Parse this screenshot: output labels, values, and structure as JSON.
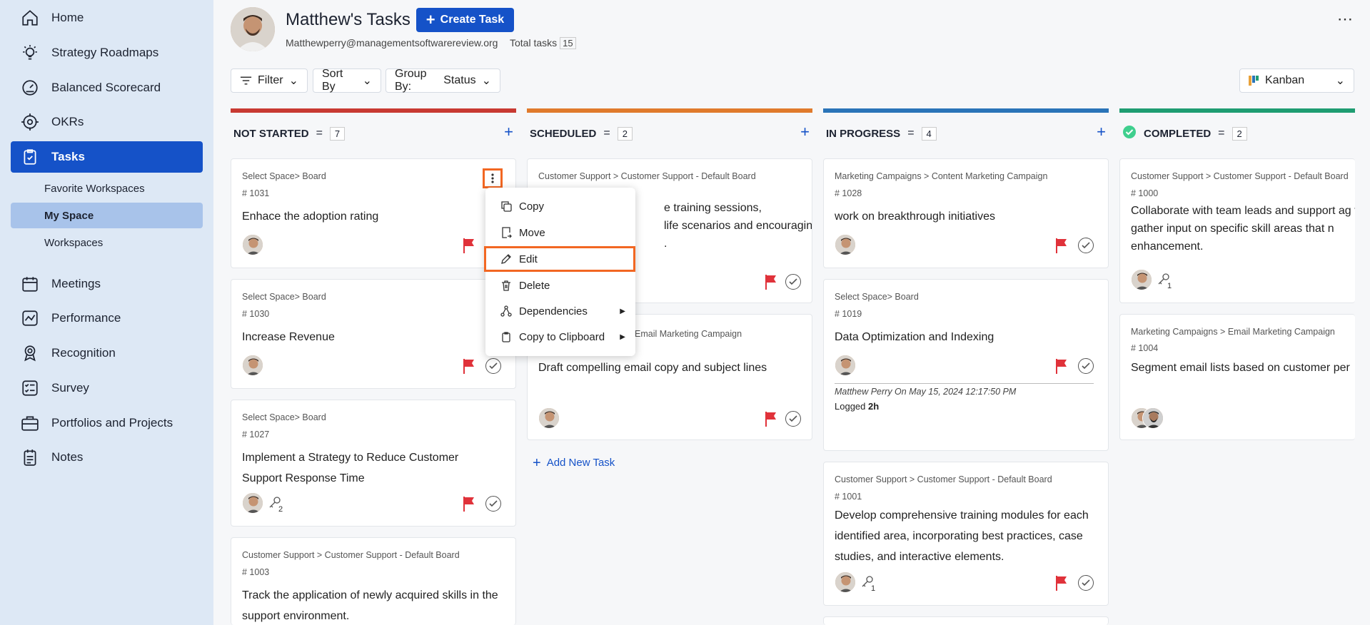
{
  "sidebar": {
    "items": [
      {
        "label": "Home",
        "icon": "home-icon"
      },
      {
        "label": "Strategy Roadmaps",
        "icon": "lightbulb-icon"
      },
      {
        "label": "Balanced Scorecard",
        "icon": "gauge-icon"
      },
      {
        "label": "OKRs",
        "icon": "target-icon"
      },
      {
        "label": "Tasks",
        "icon": "clipboard-check-icon"
      },
      {
        "label": "Meetings",
        "icon": "calendar-icon"
      },
      {
        "label": "Performance",
        "icon": "chart-line-icon"
      },
      {
        "label": "Recognition",
        "icon": "badge-icon"
      },
      {
        "label": "Survey",
        "icon": "checklist-icon"
      },
      {
        "label": "Portfolios and Projects",
        "icon": "briefcase-icon"
      },
      {
        "label": "Notes",
        "icon": "notes-icon"
      }
    ],
    "sub": [
      "Favorite Workspaces",
      "My Space",
      "Workspaces"
    ]
  },
  "header": {
    "title": "Matthew's Tasks",
    "create": "Create Task",
    "email": "Matthewperry@managementsoftwarereview.org",
    "total_label": "Total tasks",
    "total": "15"
  },
  "toolbar": {
    "filter": "Filter",
    "sort": "Sort By",
    "group_prefix": "Group By:",
    "group_value": "Status",
    "view": "Kanban"
  },
  "columns": [
    {
      "name": "NOT STARTED",
      "count": "7",
      "color": "#c83a32"
    },
    {
      "name": "SCHEDULED",
      "count": "2",
      "color": "#e07a2c"
    },
    {
      "name": "IN PROGRESS",
      "count": "4",
      "color": "#2a74b8"
    },
    {
      "name": "COMPLETED",
      "count": "2",
      "color": "#1f9d72"
    }
  ],
  "cards": {
    "ns": [
      {
        "crumb": "Select Space> Board",
        "num": "# 1031",
        "title": "Enhace the adoption rating"
      },
      {
        "crumb": "Select Space> Board",
        "num": "# 1030",
        "title": "Increase Revenue"
      },
      {
        "crumb": "Select Space> Board",
        "num": "# 1027",
        "title": "Implement a Strategy to Reduce Customer Support Response Time",
        "keys": "2"
      },
      {
        "crumb": "Customer Support > Customer Support - Default Board",
        "num": "# 1003",
        "title": "Track the application of newly acquired skills in the support environment."
      }
    ],
    "sc": [
      {
        "crumb": "Customer Support > Customer Support - Default Board",
        "title1": "e training sessions,",
        "title2": "life scenarios and encouraging",
        "title3": "."
      },
      {
        "crumb": "Email Marketing Campaign",
        "title": "Draft compelling email copy and subject lines"
      }
    ],
    "ip": [
      {
        "crumb": "Marketing Campaigns > Content Marketing Campaign",
        "num": "# 1028",
        "title": "work on breakthrough initiatives"
      },
      {
        "crumb": "Select Space> Board",
        "num": "# 1019",
        "title": "Data Optimization and Indexing",
        "log": "Matthew Perry On May 15, 2024 12:17:50 PM",
        "logged": "Logged",
        "hours": "2h"
      },
      {
        "crumb": "Customer Support > Customer Support - Default Board",
        "num": "# 1001",
        "title": "Develop comprehensive training modules for each identified area, incorporating best practices, case studies, and interactive elements.",
        "keys": "1"
      }
    ],
    "co": [
      {
        "crumb": "Customer Support > Customer Support - Default Board",
        "num": "# 1000",
        "title": "Collaborate with team leads and support ag to gather input on specific skill areas that n enhancement.",
        "keys": "1"
      },
      {
        "crumb": "Marketing Campaigns > Email Marketing Campaign",
        "num": "# 1004",
        "title": "Segment email lists based on customer per"
      }
    ]
  },
  "add_new": "Add New Task",
  "menu": {
    "items": [
      "Copy",
      "Move",
      "Edit",
      "Delete",
      "Dependencies",
      "Copy to Clipboard"
    ]
  },
  "colors": {
    "accent": "#1552c8",
    "highlight": "#f26722",
    "flag": "#e0323a"
  }
}
